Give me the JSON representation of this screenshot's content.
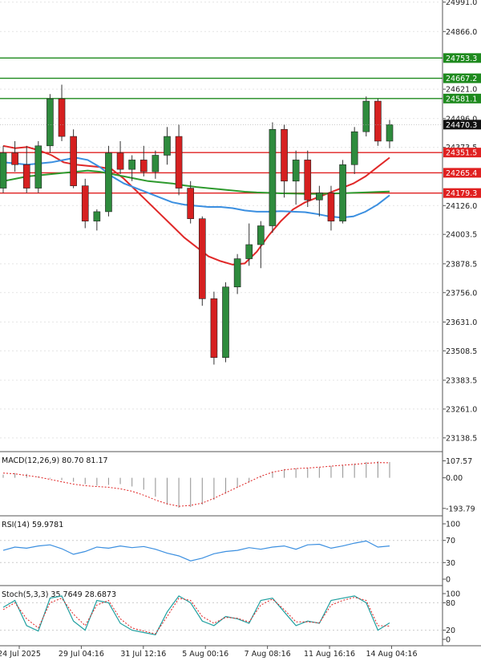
{
  "chart_data": [
    {
      "type": "candlestick",
      "price_axis": {
        "ticks": [
          24991.0,
          24866.0,
          24621.0,
          24496.0,
          24373.5,
          24126.0,
          24003.5,
          23878.5,
          23756.0,
          23631.0,
          23508.5,
          23383.5,
          23261.0,
          23138.5
        ],
        "tick_labels": [
          "24991.0",
          "24866.0",
          "24621.0",
          "24496.0",
          "24373.5",
          "24126.0",
          "24003.5",
          "23878.5",
          "23756.0",
          "23631.0",
          "23508.5",
          "23383.5",
          "23261.0",
          "23138.5"
        ],
        "range": [
          23080,
          25000
        ]
      },
      "time_axis": {
        "labels": [
          "24 Jul 2025",
          "29 Jul 04:16",
          "31 Jul 12:16",
          "5 Aug 00:16",
          "7 Aug 08:16",
          "11 Aug 16:16",
          "14 Aug 04:16"
        ]
      },
      "levels": [
        {
          "label": "24753.3",
          "value": 24753.3,
          "color": "#1e8a1e"
        },
        {
          "label": "24667.2",
          "value": 24667.2,
          "color": "#1e8a1e"
        },
        {
          "label": "24581.1",
          "value": 24581.1,
          "color": "#1e8a1e"
        },
        {
          "label": "24351.5",
          "value": 24351.5,
          "color": "#e02020"
        },
        {
          "label": "24265.4",
          "value": 24265.4,
          "color": "#e02020"
        },
        {
          "label": "24179.3",
          "value": 24179.3,
          "color": "#e02020"
        }
      ],
      "current_price": {
        "label": "24470.3",
        "value": 24470.3
      },
      "moving_averages": [
        {
          "color": "#e02828",
          "values": [
            24380,
            24370,
            24375,
            24360,
            24340,
            24310,
            24300,
            24295,
            24290,
            24280,
            24240,
            24190,
            24140,
            24090,
            24040,
            23990,
            23950,
            23910,
            23890,
            23875,
            23880,
            23930,
            24000,
            24060,
            24110,
            24140,
            24160,
            24180,
            24200,
            24220,
            24250,
            24290,
            24330
          ]
        },
        {
          "color": "#3b8fe0",
          "values": [
            24310,
            24305,
            24300,
            24305,
            24310,
            24320,
            24330,
            24320,
            24290,
            24250,
            24220,
            24200,
            24180,
            24160,
            24140,
            24130,
            24125,
            24120,
            24120,
            24115,
            24105,
            24100,
            24100,
            24102,
            24100,
            24098,
            24090,
            24080,
            24075,
            24080,
            24100,
            24130,
            24170
          ]
        },
        {
          "color": "#2e9a2e",
          "values": [
            24230,
            24240,
            24250,
            24255,
            24260,
            24265,
            24270,
            24275,
            24270,
            24260,
            24250,
            24240,
            24230,
            24225,
            24220,
            24212,
            24205,
            24200,
            24195,
            24190,
            24185,
            24182,
            24180,
            24178,
            24177,
            24176,
            24176,
            24177,
            24178,
            24180,
            24182,
            24184,
            24186
          ]
        }
      ],
      "candles": [
        {
          "o": 24200,
          "h": 24380,
          "l": 24180,
          "c": 24350
        },
        {
          "o": 24350,
          "h": 24400,
          "l": 24270,
          "c": 24300
        },
        {
          "o": 24300,
          "h": 24380,
          "l": 24180,
          "c": 24200
        },
        {
          "o": 24200,
          "h": 24400,
          "l": 24180,
          "c": 24380
        },
        {
          "o": 24380,
          "h": 24600,
          "l": 24350,
          "c": 24580
        },
        {
          "o": 24580,
          "h": 24640,
          "l": 24400,
          "c": 24420
        },
        {
          "o": 24420,
          "h": 24450,
          "l": 24200,
          "c": 24210
        },
        {
          "o": 24210,
          "h": 24240,
          "l": 24030,
          "c": 24060
        },
        {
          "o": 24060,
          "h": 24110,
          "l": 24020,
          "c": 24100
        },
        {
          "o": 24100,
          "h": 24380,
          "l": 24080,
          "c": 24350
        },
        {
          "o": 24350,
          "h": 24400,
          "l": 24260,
          "c": 24280
        },
        {
          "o": 24280,
          "h": 24340,
          "l": 24230,
          "c": 24320
        },
        {
          "o": 24320,
          "h": 24380,
          "l": 24250,
          "c": 24270
        },
        {
          "o": 24270,
          "h": 24360,
          "l": 24240,
          "c": 24340
        },
        {
          "o": 24340,
          "h": 24460,
          "l": 24300,
          "c": 24420
        },
        {
          "o": 24420,
          "h": 24470,
          "l": 24170,
          "c": 24200
        },
        {
          "o": 24200,
          "h": 24230,
          "l": 24050,
          "c": 24070
        },
        {
          "o": 24070,
          "h": 24080,
          "l": 23700,
          "c": 23730
        },
        {
          "o": 23730,
          "h": 23760,
          "l": 23450,
          "c": 23480
        },
        {
          "o": 23480,
          "h": 23800,
          "l": 23460,
          "c": 23780
        },
        {
          "o": 23780,
          "h": 23920,
          "l": 23750,
          "c": 23900
        },
        {
          "o": 23900,
          "h": 24050,
          "l": 23870,
          "c": 23960
        },
        {
          "o": 23960,
          "h": 24060,
          "l": 23860,
          "c": 24040
        },
        {
          "o": 24040,
          "h": 24480,
          "l": 24010,
          "c": 24450
        },
        {
          "o": 24450,
          "h": 24470,
          "l": 24160,
          "c": 24230
        },
        {
          "o": 24230,
          "h": 24360,
          "l": 24130,
          "c": 24320
        },
        {
          "o": 24320,
          "h": 24360,
          "l": 24120,
          "c": 24150
        },
        {
          "o": 24150,
          "h": 24210,
          "l": 24080,
          "c": 24180
        },
        {
          "o": 24180,
          "h": 24210,
          "l": 24020,
          "c": 24060
        },
        {
          "o": 24060,
          "h": 24320,
          "l": 24050,
          "c": 24300
        },
        {
          "o": 24300,
          "h": 24460,
          "l": 24260,
          "c": 24440
        },
        {
          "o": 24440,
          "h": 24590,
          "l": 24420,
          "c": 24570
        },
        {
          "o": 24570,
          "h": 24580,
          "l": 24380,
          "c": 24400
        },
        {
          "o": 24400,
          "h": 24490,
          "l": 24370,
          "c": 24470
        }
      ]
    },
    {
      "type": "line",
      "indicator": "MACD",
      "label": "MACD(12,26,9) 80.70 81.17",
      "ticks": [
        107.57,
        0.0,
        -193.79
      ],
      "tick_labels": [
        "107.57",
        "0.00",
        "-193.79"
      ],
      "range": [
        -200,
        115
      ],
      "histogram": [
        20,
        30,
        25,
        10,
        -5,
        -15,
        -25,
        -40,
        -50,
        -45,
        -40,
        -55,
        -75,
        -120,
        -170,
        -190,
        -185,
        -170,
        -140,
        -100,
        -60,
        -30,
        10,
        40,
        55,
        60,
        60,
        65,
        75,
        80,
        90,
        100,
        105,
        100
      ],
      "signal": [
        30,
        25,
        15,
        5,
        -10,
        -25,
        -40,
        -50,
        -55,
        -60,
        -70,
        -85,
        -110,
        -140,
        -165,
        -180,
        -175,
        -160,
        -130,
        -95,
        -60,
        -25,
        10,
        35,
        50,
        58,
        62,
        67,
        74,
        80,
        85,
        92,
        96,
        95
      ]
    },
    {
      "type": "line",
      "indicator": "RSI",
      "label": "RSI(14) 59.9781",
      "ticks": [
        100,
        70,
        30,
        0
      ],
      "tick_labels": [
        "100",
        "70",
        "30",
        "0"
      ],
      "range": [
        0,
        100
      ],
      "values": [
        52,
        58,
        56,
        60,
        62,
        55,
        45,
        50,
        58,
        56,
        60,
        57,
        59,
        54,
        47,
        42,
        33,
        38,
        46,
        50,
        52,
        57,
        54,
        58,
        60,
        54,
        62,
        63,
        56,
        60,
        65,
        69,
        58,
        60
      ]
    },
    {
      "type": "line",
      "indicator": "Stochastic",
      "label": "Stoch(5,3,3) 35.7649 28.6873",
      "ticks": [
        100,
        80,
        20,
        0
      ],
      "tick_labels": [
        "100",
        "80",
        "20",
        "0"
      ],
      "range": [
        0,
        100
      ],
      "k": [
        70,
        85,
        30,
        18,
        90,
        95,
        40,
        20,
        85,
        80,
        35,
        20,
        15,
        10,
        60,
        95,
        80,
        40,
        30,
        50,
        45,
        35,
        85,
        90,
        60,
        30,
        40,
        35,
        85,
        90,
        95,
        80,
        20,
        36
      ],
      "d": [
        65,
        80,
        45,
        25,
        80,
        90,
        55,
        30,
        75,
        85,
        45,
        25,
        18,
        12,
        50,
        90,
        85,
        50,
        35,
        48,
        46,
        38,
        75,
        88,
        65,
        38,
        38,
        36,
        75,
        85,
        92,
        85,
        30,
        29
      ]
    }
  ]
}
